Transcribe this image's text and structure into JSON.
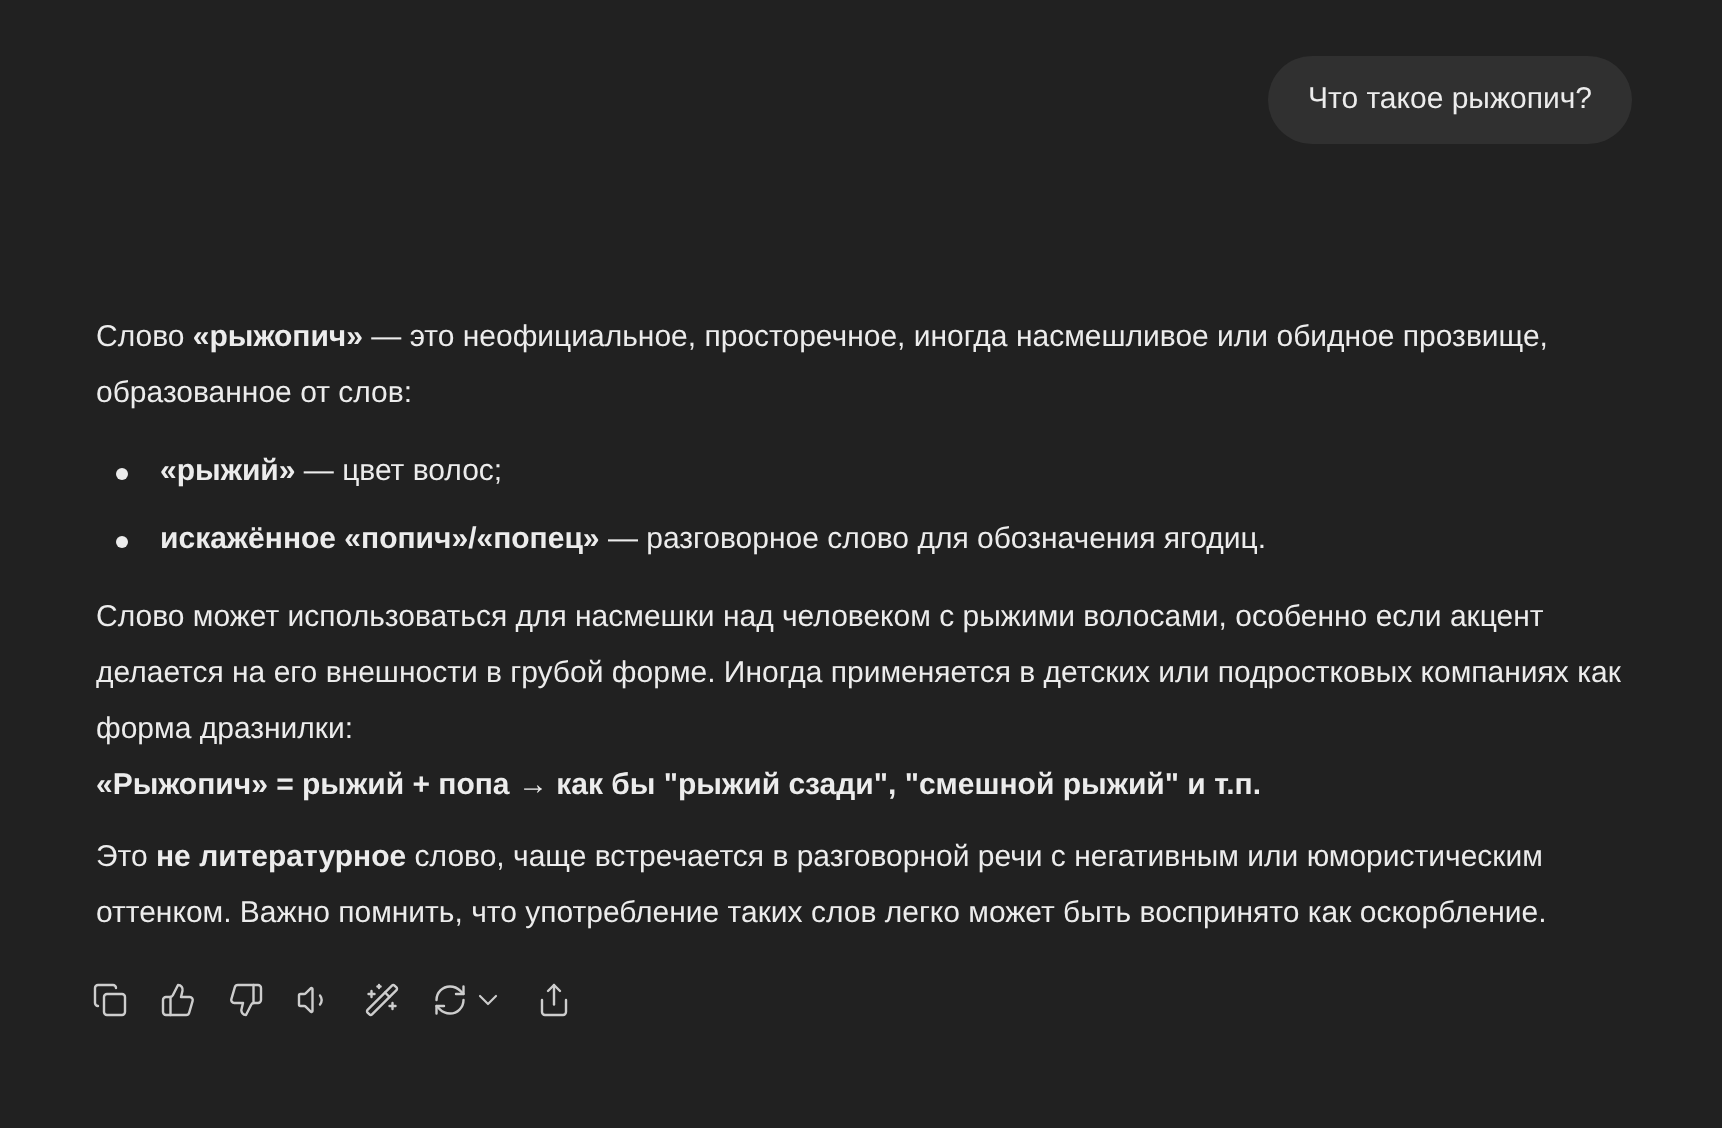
{
  "user_message": "Что такое рыжопич?",
  "blocks": [
    {
      "kind": "paragraph",
      "text": "Слово **«рыжопич»** — это неофициальное, просторечное, иногда насмешливое или обидное прозвище, образованное от слов:"
    },
    {
      "kind": "list",
      "items": [
        "**«рыжий»** — цвет волос;",
        "**искажённое «попич»/«попец»** — разговорное слово для обозначения ягодиц."
      ]
    },
    {
      "kind": "paragraph",
      "text": "Слово может использоваться для насмешки над человеком с рыжими волосами, особенно если акцент делается на его внешности в грубой форме. Иногда применяется в детских или подростковых компаниях как форма дразнилки:"
    },
    {
      "kind": "strong_line",
      "text": "«Рыжопич» = рыжий + попа → как бы \"рыжий сзади\", \"смешной рыжий\" и т.п."
    },
    {
      "kind": "paragraph",
      "text": "Это **не литературное** слово, чаще встречается в разговорной речи с негативным или юмористическим оттенком. Важно помнить, что употребление таких слов легко может быть воспринято как оскорбление."
    }
  ],
  "actions": [
    {
      "kind": "copy"
    },
    {
      "kind": "like"
    },
    {
      "kind": "dislike"
    },
    {
      "kind": "read_aloud"
    },
    {
      "kind": "edit"
    },
    {
      "kind": "regenerate"
    },
    {
      "kind": "share"
    }
  ]
}
